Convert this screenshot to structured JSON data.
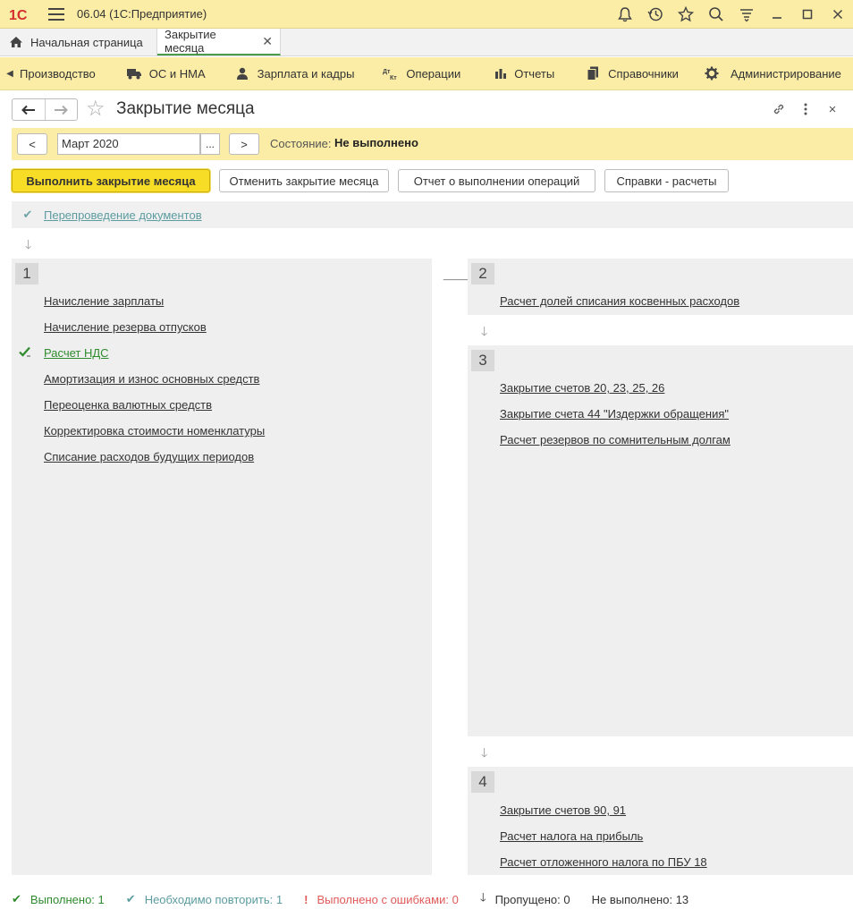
{
  "titlebar": {
    "logo": "1С",
    "title": "06.04  (1С:Предприятие)",
    "icons": [
      "bell-icon",
      "history-icon",
      "star-icon",
      "search-icon",
      "settings-menu-icon",
      "minimize-icon",
      "maximize-icon",
      "close-icon"
    ]
  },
  "tabs": {
    "home_label": "Начальная страница",
    "active_label": "Закрытие месяца",
    "close_glyph": "✕"
  },
  "sections": [
    {
      "label": "Производство",
      "icon": "production-icon"
    },
    {
      "label": "ОС и НМА",
      "icon": "truck-icon"
    },
    {
      "label": "Зарплата и кадры",
      "icon": "person-icon"
    },
    {
      "label": "Операции",
      "icon": "dt-kt-icon"
    },
    {
      "label": "Отчеты",
      "icon": "bar-chart-icon"
    },
    {
      "label": "Справочники",
      "icon": "books-icon"
    },
    {
      "label": "Администрирование",
      "icon": "gear-icon"
    }
  ],
  "form": {
    "title": "Закрытие месяца",
    "back": "🡐",
    "forward": "🡒",
    "link_icon": "link-icon",
    "more_icon": "more-icon",
    "close": "×"
  },
  "period": {
    "prev": "<",
    "next": ">",
    "value": "Март 2020",
    "choose": "...",
    "state_label": "Состояние:",
    "state_value": "Не выполнено"
  },
  "commands": {
    "execute": "Выполнить закрытие месяца",
    "cancel": "Отменить закрытие месяца",
    "report": "Отчет о выполнении операций",
    "refs": "Справки - расчеты"
  },
  "repost": {
    "label": "Перепроведение документов",
    "status": "repeat"
  },
  "groups": [
    {
      "number": "1",
      "items": [
        {
          "label": "Начисление зарплаты",
          "status": "not_done"
        },
        {
          "label": "Начисление резерва отпусков",
          "status": "not_done"
        },
        {
          "label": "Расчет НДС",
          "status": "done"
        },
        {
          "label": "Амортизация и износ основных средств",
          "status": "not_done"
        },
        {
          "label": "Переоценка валютных средств",
          "status": "not_done"
        },
        {
          "label": "Корректировка стоимости номенклатуры",
          "status": "not_done"
        },
        {
          "label": "Списание расходов будущих периодов",
          "status": "not_done"
        }
      ]
    },
    {
      "number": "2",
      "items": [
        {
          "label": "Расчет долей списания косвенных расходов",
          "status": "not_done"
        }
      ]
    },
    {
      "number": "3",
      "items": [
        {
          "label": "Закрытие счетов 20, 23, 25, 26",
          "status": "not_done"
        },
        {
          "label": "Закрытие счета 44 \"Издержки обращения\"",
          "status": "not_done"
        },
        {
          "label": "Расчет резервов по сомнительным долгам",
          "status": "not_done"
        }
      ]
    },
    {
      "number": "4",
      "items": [
        {
          "label": "Закрытие счетов 90, 91",
          "status": "not_done"
        },
        {
          "label": "Расчет налога на прибыль",
          "status": "not_done"
        },
        {
          "label": "Расчет отложенного налога по ПБУ 18",
          "status": "not_done"
        }
      ]
    }
  ],
  "footer": {
    "done_label": "Выполнено:",
    "done_count": "1",
    "repeat_label": "Необходимо повторить:",
    "repeat_count": "1",
    "errors_label": "Выполнено с ошибками:",
    "errors_count": "0",
    "skipped_label": "Пропущено:",
    "skipped_count": "0",
    "notdone_label": "Не выполнено:",
    "notdone_count": "13"
  },
  "colors": {
    "accent_yellow": "#fbeda6",
    "primary_button": "#f8dd26",
    "done_green": "#2e8b2e",
    "repeat_teal": "#5c9ca0",
    "error_red": "#e05a5a"
  }
}
